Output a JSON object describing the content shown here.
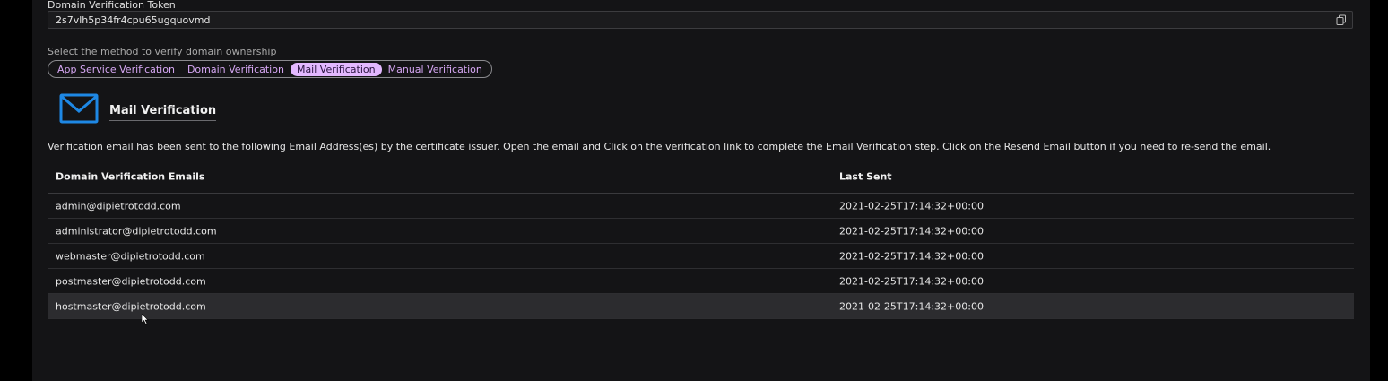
{
  "token": {
    "label": "Domain Verification Token",
    "value": "2s7vlh5p34fr4cpu65ugquovmd"
  },
  "methods": {
    "label": "Select the method to verify domain ownership",
    "options": [
      {
        "label": "App Service Verification",
        "selected": false
      },
      {
        "label": "Domain Verification",
        "selected": false
      },
      {
        "label": "Mail Verification",
        "selected": true
      },
      {
        "label": "Manual Verification",
        "selected": false
      }
    ]
  },
  "mail": {
    "icon": "mail-icon",
    "title": "Mail Verification",
    "description": "Verification email has been sent to the following Email Address(es) by the certificate issuer. Open the email and Click on the verification link to complete the Email Verification step. Click on the Resend Email button if you need to re-send the email."
  },
  "table": {
    "headers": {
      "email": "Domain Verification Emails",
      "last_sent": "Last Sent"
    },
    "rows": [
      {
        "email": "admin@dipietrotodd.com",
        "last_sent": "2021-02-25T17:14:32+00:00"
      },
      {
        "email": "administrator@dipietrotodd.com",
        "last_sent": "2021-02-25T17:14:32+00:00"
      },
      {
        "email": "webmaster@dipietrotodd.com",
        "last_sent": "2021-02-25T17:14:32+00:00"
      },
      {
        "email": "postmaster@dipietrotodd.com",
        "last_sent": "2021-02-25T17:14:32+00:00"
      },
      {
        "email": "hostmaster@dipietrotodd.com",
        "last_sent": "2021-02-25T17:14:32+00:00"
      }
    ]
  },
  "colors": {
    "accent": "#e3b8ff",
    "mail_icon": "#1e88e5",
    "background": "#141416"
  }
}
